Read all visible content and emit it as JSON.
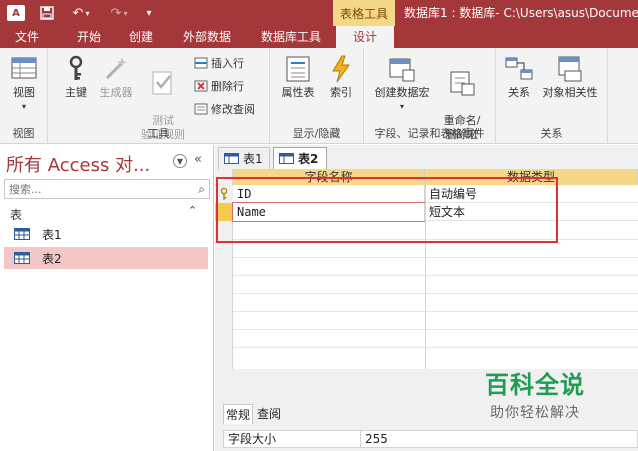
{
  "title_bar": {
    "app_icon_text": "A",
    "context_tab": "表格工具",
    "document_title": "数据库1 : 数据库- C:\\Users\\asus\\Docume"
  },
  "ribbon_tabs": [
    "文件",
    "开始",
    "创建",
    "外部数据",
    "数据库工具",
    "设计"
  ],
  "ribbon": {
    "groups": {
      "views": {
        "label": "视图",
        "buttons": [
          "视图"
        ]
      },
      "tools": {
        "label": "工具",
        "big_buttons": [
          "主键",
          "生成器",
          "测试\n验证规则"
        ],
        "small_buttons": [
          "插入行",
          "删除行",
          "修改查阅"
        ]
      },
      "show_hide": {
        "label": "显示/隐藏",
        "buttons": [
          "属性表",
          "索引"
        ]
      },
      "field_events": {
        "label": "字段、记录和表格事件",
        "buttons": [
          "创建数据宏",
          "重命名/\n删除宏"
        ]
      },
      "relationships": {
        "label": "关系",
        "buttons": [
          "关系",
          "对象相关性"
        ]
      }
    }
  },
  "nav_pane": {
    "title": "所有 Access 对...",
    "search_placeholder": "搜索...",
    "section": "表",
    "items": [
      "表1",
      "表2"
    ]
  },
  "doc_tabs": [
    "表1",
    "表2"
  ],
  "design_grid": {
    "headers": [
      "字段名称",
      "数据类型"
    ],
    "rows": [
      {
        "name": "ID",
        "type": "自动编号",
        "primary_key": true
      },
      {
        "name": "Name",
        "type": "短文本",
        "primary_key": false
      }
    ]
  },
  "properties": {
    "tabs": [
      "常规",
      "查阅"
    ],
    "rows": [
      {
        "label": "字段大小",
        "value": "255"
      }
    ]
  },
  "watermark": {
    "line1": "百科全说",
    "line2": "助你轻松解决"
  },
  "colors": {
    "access_red": "#a4373a",
    "header_gold": "#f5d78a",
    "highlight_red": "#e03131",
    "selected_nav": "#f4c7c7"
  }
}
